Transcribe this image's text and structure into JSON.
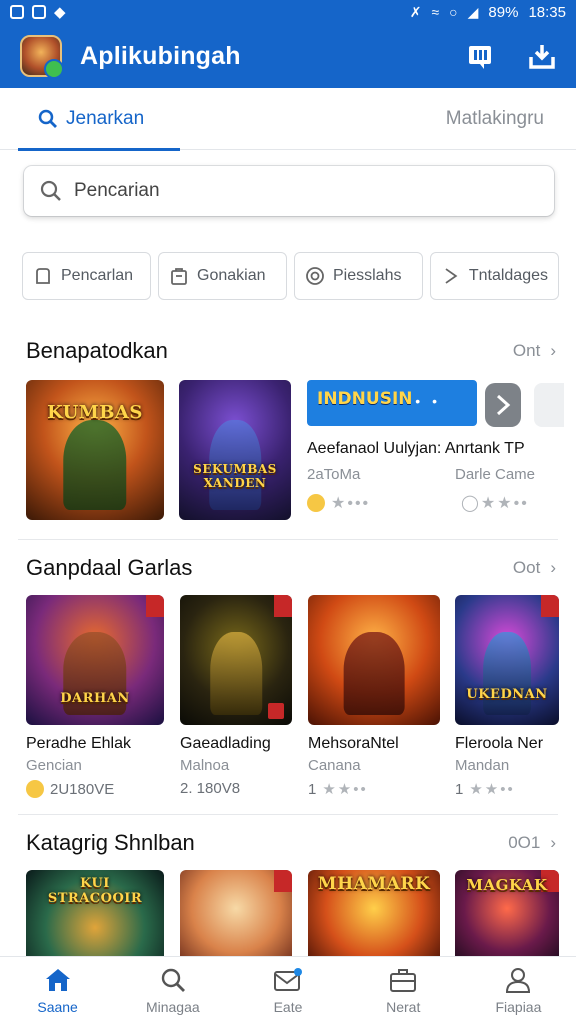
{
  "status_bar": {
    "battery": "89%",
    "time": "18:35"
  },
  "app": {
    "title": "Aplikubingah"
  },
  "tabs": [
    {
      "label": "Jenarkan",
      "active": true
    },
    {
      "label": "Matlakingru",
      "active": false
    }
  ],
  "search": {
    "placeholder": "Pencarian"
  },
  "chips": [
    {
      "label": "Pencarlan",
      "icon": "document-icon"
    },
    {
      "label": "Gonakian",
      "icon": "bag-icon"
    },
    {
      "label": "Piesslahs",
      "icon": "badge-icon"
    },
    {
      "label": "Tntaldages",
      "icon": "play-icon"
    }
  ],
  "sections": {
    "recommended": {
      "title": "Benapatodkan",
      "more": "Ont",
      "cards": [
        {
          "art": "KUMBAS",
          "title": "",
          "sub": "",
          "meta": ""
        },
        {
          "art": "SEKUMBAS XANDEN",
          "title": "",
          "sub": "",
          "meta": ""
        }
      ],
      "banner": {
        "text": "INDNUSIN",
        "title": "Aeefanaol Uulyjan: Anrtank TP",
        "sub_left": "2aToMa",
        "sub_right": "Darle Came"
      }
    },
    "popular": {
      "title": "Ganpdaal Garlas",
      "more": "Oot",
      "cards": [
        {
          "art": "DARHAN",
          "title": "Peradhe Ehlak",
          "sub": "Gencian",
          "meta": "2U180VE"
        },
        {
          "art": "",
          "title": "Gaeadlading",
          "sub": "Malnoa",
          "meta": "2. 180V8"
        },
        {
          "art": "",
          "title": "MehsoraNtel",
          "sub": "Canana",
          "meta": "1"
        },
        {
          "art": "UKEDNAN",
          "title": "Fleroola Ner",
          "sub": "Mandan",
          "meta": "1"
        }
      ]
    },
    "category": {
      "title": "Katagrig Shnlban",
      "more": "0O1",
      "cards": [
        {
          "art": "KUI STRACOOIR"
        },
        {
          "art": ""
        },
        {
          "art": "MHAMARK"
        },
        {
          "art": "MAGKAK"
        }
      ]
    }
  },
  "bottom_nav": [
    {
      "label": "Saane",
      "icon": "home-icon",
      "active": true
    },
    {
      "label": "Minagaa",
      "icon": "search-icon",
      "active": false
    },
    {
      "label": "Eate",
      "icon": "mail-icon",
      "active": false
    },
    {
      "label": "Nerat",
      "icon": "briefcase-icon",
      "active": false
    },
    {
      "label": "Fiapiaa",
      "icon": "person-icon",
      "active": false
    }
  ],
  "colors": {
    "primary": "#1565c9",
    "muted": "#8a8f96"
  }
}
